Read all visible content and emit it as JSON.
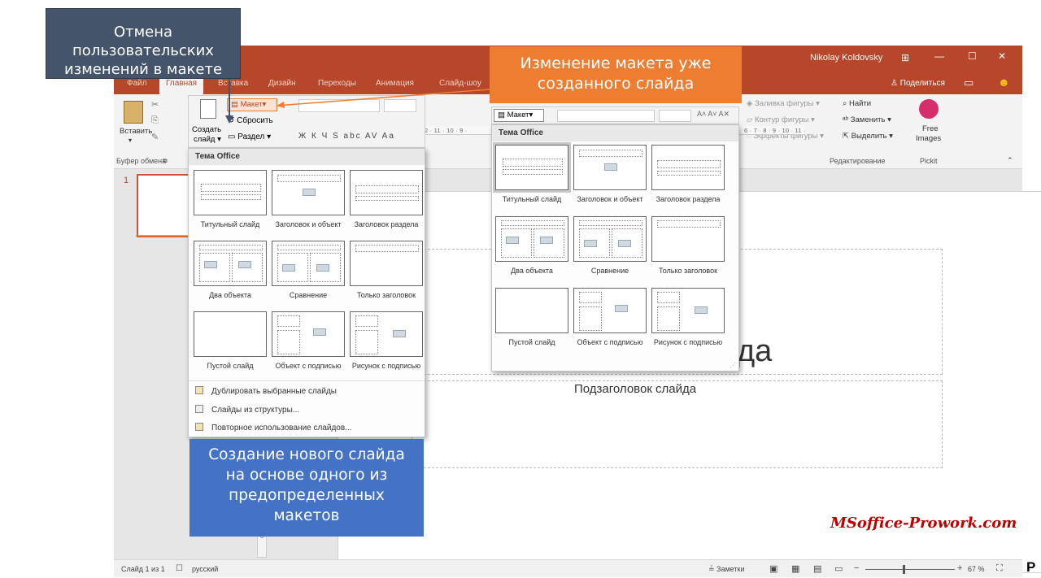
{
  "window": {
    "user": "Nikolay Koldovsky",
    "share": "Поделиться",
    "tabs": [
      "Файл",
      "Главная",
      "Вставка",
      "Дизайн",
      "Переходы",
      "Анимация",
      "Слайд-шоу"
    ]
  },
  "ribbon": {
    "paste": "Вставить",
    "clipboard_group": "Буфер обмена",
    "new_slide_line1": "Создать",
    "new_slide_line2": "слайд",
    "layout": "Макет",
    "reset": "Сбросить",
    "section": "Раздел",
    "font_buttons": "Ж К Ч S abc AV Aa",
    "shape_fill": "Заливка фигуры",
    "shape_outline": "Контур фигуры",
    "shape_effects": "Эффекты фигуры",
    "find": "Найти",
    "replace": "Заменить",
    "select": "Выделить",
    "editing_group": "Редактирование",
    "free_images_1": "Free",
    "free_images_2": "Images",
    "pickit_group": "Pickit"
  },
  "ruler_left": "2 · 11 · 10 · 9 ·",
  "ruler_right": "6 · 7 · 8 · 9 · 10 · 11 · 12 · 13 · 14 · 15 · 16 ·",
  "slide": {
    "number": "1",
    "title_fragment": "да",
    "subtitle": "Подзаголовок слайда"
  },
  "left_menu": {
    "theme": "Тема Office",
    "layouts": [
      {
        "caption": "Титульный слайд"
      },
      {
        "caption": "Заголовок и объект"
      },
      {
        "caption": "Заголовок раздела"
      },
      {
        "caption": "Два объекта"
      },
      {
        "caption": "Сравнение"
      },
      {
        "caption": "Только заголовок"
      },
      {
        "caption": "Пустой слайд"
      },
      {
        "caption": "Объект с подписью"
      },
      {
        "caption": "Рисунок с подписью"
      }
    ],
    "items": [
      "Дублировать выбранные слайды",
      "Слайды из структуры...",
      "Повторное использование слайдов..."
    ]
  },
  "right_menu": {
    "button": "Макет",
    "theme": "Тема Office",
    "layouts": [
      {
        "caption": "Титульный слайд"
      },
      {
        "caption": "Заголовок и объект"
      },
      {
        "caption": "Заголовок раздела"
      },
      {
        "caption": "Два объекта"
      },
      {
        "caption": "Сравнение"
      },
      {
        "caption": "Только заголовок"
      },
      {
        "caption": "Пустой слайд"
      },
      {
        "caption": "Объект с подписью"
      },
      {
        "caption": "Рисунок с подписью"
      }
    ]
  },
  "callouts": {
    "reset_line1": "Отмена пользовательских",
    "reset_line2": "изменений в макете",
    "layout_line1": "Изменение макета уже",
    "layout_line2": "созданного слайда",
    "new_line1": "Создание нового слайда",
    "new_line2": "на основе одного из",
    "new_line3": "предопределенных",
    "new_line4": "макетов"
  },
  "status": {
    "slide_of": "Слайд 1 из 1",
    "language": "русский",
    "notes": "Заметки",
    "zoom": "67 %"
  },
  "watermark": "MSoffice-Prowork.com",
  "corner_text": "Р",
  "colors": {
    "accent": "#b7472a",
    "callout_dark": "#44546a",
    "callout_orange": "#ed7d31",
    "callout_blue": "#4472c4"
  }
}
